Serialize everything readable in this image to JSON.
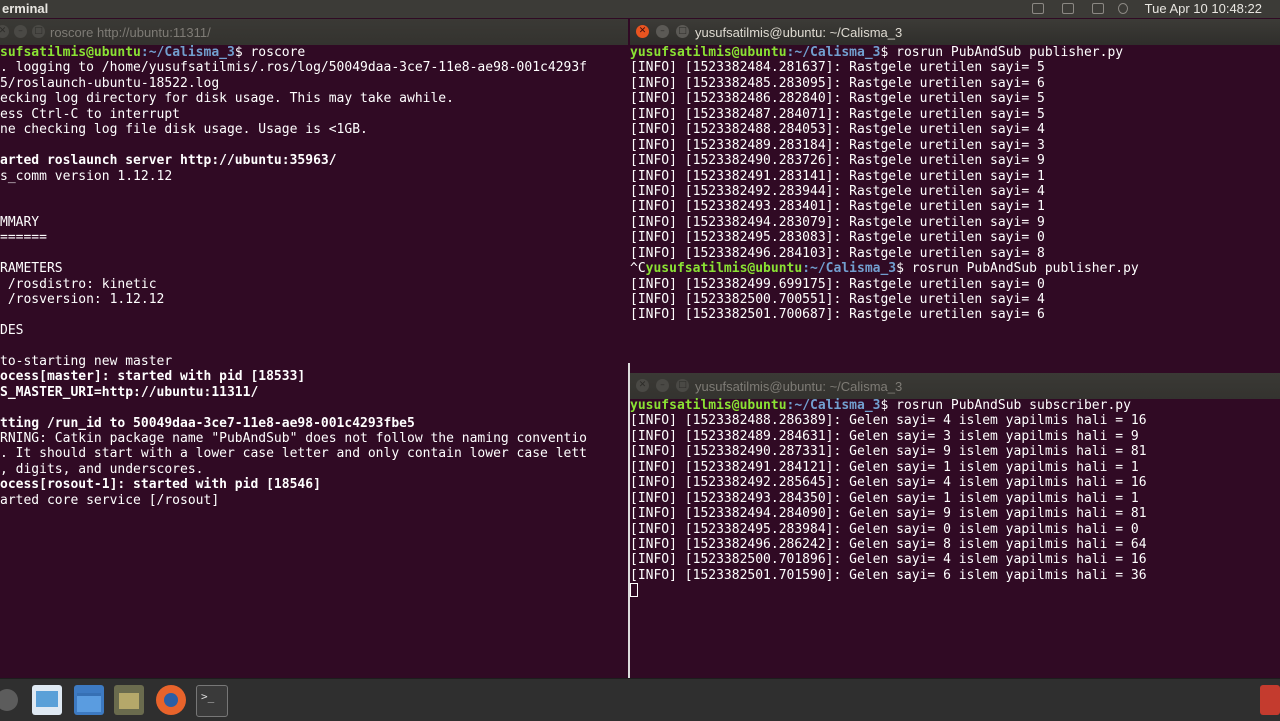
{
  "top_panel": {
    "app_title": "erminal",
    "clock": "Tue Apr 10 10:48:22"
  },
  "windows": {
    "left": {
      "title": "roscore http://ubuntu:11311/",
      "prompt_user": "yusufsatilmis@ubuntu",
      "prompt_path": ":~/Calisma_3",
      "lines": [
        {
          "t": "sufsatilmis@ubuntu:~/Calisma_3$ roscore",
          "s": "prompt"
        },
        {
          "t": ". logging to /home/yusufsatilmis/.ros/log/50049daa-3ce7-11e8-ae98-001c4293f",
          "s": ""
        },
        {
          "t": "5/roslaunch-ubuntu-18522.log",
          "s": ""
        },
        {
          "t": "ecking log directory for disk usage. This may take awhile.",
          "s": ""
        },
        {
          "t": "ess Ctrl-C to interrupt",
          "s": ""
        },
        {
          "t": "ne checking log file disk usage. Usage is <1GB.",
          "s": ""
        },
        {
          "t": "",
          "s": ""
        },
        {
          "t": "arted roslaunch server http://ubuntu:35963/",
          "s": "b"
        },
        {
          "t": "s_comm version 1.12.12",
          "s": ""
        },
        {
          "t": "",
          "s": ""
        },
        {
          "t": "",
          "s": ""
        },
        {
          "t": "MMARY",
          "s": ""
        },
        {
          "t": "======",
          "s": ""
        },
        {
          "t": "",
          "s": ""
        },
        {
          "t": "RAMETERS",
          "s": ""
        },
        {
          "t": " /rosdistro: kinetic",
          "s": ""
        },
        {
          "t": " /rosversion: 1.12.12",
          "s": ""
        },
        {
          "t": "",
          "s": ""
        },
        {
          "t": "DES",
          "s": ""
        },
        {
          "t": "",
          "s": ""
        },
        {
          "t": "to-starting new master",
          "s": ""
        },
        {
          "t": "ocess[master]: started with pid [18533]",
          "s": "b"
        },
        {
          "t": "S_MASTER_URI=http://ubuntu:11311/",
          "s": "b"
        },
        {
          "t": "",
          "s": ""
        },
        {
          "t": "tting /run_id to 50049daa-3ce7-11e8-ae98-001c4293fbe5",
          "s": "b"
        },
        {
          "t": "RNING: Catkin package name \"PubAndSub\" does not follow the naming conventio",
          "s": ""
        },
        {
          "t": ". It should start with a lower case letter and only contain lower case lett",
          "s": ""
        },
        {
          "t": ", digits, and underscores.",
          "s": ""
        },
        {
          "t": "ocess[rosout-1]: started with pid [18546]",
          "s": "b"
        },
        {
          "t": "arted core service [/rosout]",
          "s": ""
        }
      ]
    },
    "top_right": {
      "title": "yusufsatilmis@ubuntu: ~/Calisma_3",
      "lines": [
        {
          "u": "yusufsatilmis@ubuntu",
          "p": ":~/Calisma_3",
          "c": "$ rosrun PubAndSub publisher.py",
          "s": "prompt2"
        },
        {
          "t": "[INFO] [1523382484.281637]: Rastgele uretilen sayi= 5",
          "s": ""
        },
        {
          "t": "[INFO] [1523382485.283095]: Rastgele uretilen sayi= 6",
          "s": ""
        },
        {
          "t": "[INFO] [1523382486.282840]: Rastgele uretilen sayi= 5",
          "s": ""
        },
        {
          "t": "[INFO] [1523382487.284071]: Rastgele uretilen sayi= 5",
          "s": ""
        },
        {
          "t": "[INFO] [1523382488.284053]: Rastgele uretilen sayi= 4",
          "s": ""
        },
        {
          "t": "[INFO] [1523382489.283184]: Rastgele uretilen sayi= 3",
          "s": ""
        },
        {
          "t": "[INFO] [1523382490.283726]: Rastgele uretilen sayi= 9",
          "s": ""
        },
        {
          "t": "[INFO] [1523382491.283141]: Rastgele uretilen sayi= 1",
          "s": ""
        },
        {
          "t": "[INFO] [1523382492.283944]: Rastgele uretilen sayi= 4",
          "s": ""
        },
        {
          "t": "[INFO] [1523382493.283401]: Rastgele uretilen sayi= 1",
          "s": ""
        },
        {
          "t": "[INFO] [1523382494.283079]: Rastgele uretilen sayi= 9",
          "s": ""
        },
        {
          "t": "[INFO] [1523382495.283083]: Rastgele uretilen sayi= 0",
          "s": ""
        },
        {
          "t": "[INFO] [1523382496.284103]: Rastgele uretilen sayi= 8",
          "s": ""
        },
        {
          "pre": "^C",
          "u": "yusufsatilmis@ubuntu",
          "p": ":~/Calisma_3",
          "c": "$ rosrun PubAndSub publisher.py",
          "s": "prompt2"
        },
        {
          "t": "[INFO] [1523382499.699175]: Rastgele uretilen sayi= 0",
          "s": ""
        },
        {
          "t": "[INFO] [1523382500.700551]: Rastgele uretilen sayi= 4",
          "s": ""
        },
        {
          "t": "[INFO] [1523382501.700687]: Rastgele uretilen sayi= 6",
          "s": ""
        }
      ]
    },
    "bottom_right": {
      "title": "yusufsatilmis@ubuntu: ~/Calisma_3",
      "lines": [
        {
          "u": "yusufsatilmis@ubuntu",
          "p": ":~/Calisma_3",
          "c": "$ rosrun PubAndSub subscriber.py",
          "s": "prompt2"
        },
        {
          "t": "[INFO] [1523382488.286389]: Gelen sayi= 4 islem yapilmis hali = 16",
          "s": ""
        },
        {
          "t": "[INFO] [1523382489.284631]: Gelen sayi= 3 islem yapilmis hali = 9",
          "s": ""
        },
        {
          "t": "[INFO] [1523382490.287331]: Gelen sayi= 9 islem yapilmis hali = 81",
          "s": ""
        },
        {
          "t": "[INFO] [1523382491.284121]: Gelen sayi= 1 islem yapilmis hali = 1",
          "s": ""
        },
        {
          "t": "[INFO] [1523382492.285645]: Gelen sayi= 4 islem yapilmis hali = 16",
          "s": ""
        },
        {
          "t": "[INFO] [1523382493.284350]: Gelen sayi= 1 islem yapilmis hali = 1",
          "s": ""
        },
        {
          "t": "[INFO] [1523382494.284090]: Gelen sayi= 9 islem yapilmis hali = 81",
          "s": ""
        },
        {
          "t": "[INFO] [1523382495.283984]: Gelen sayi= 0 islem yapilmis hali = 0",
          "s": ""
        },
        {
          "t": "[INFO] [1523382496.286242]: Gelen sayi= 8 islem yapilmis hali = 64",
          "s": ""
        },
        {
          "t": "[INFO] [1523382500.701896]: Gelen sayi= 4 islem yapilmis hali = 16",
          "s": ""
        },
        {
          "t": "[INFO] [1523382501.701590]: Gelen sayi= 6 islem yapilmis hali = 36",
          "s": ""
        }
      ]
    }
  },
  "taskbar": {
    "items": [
      "show-desktop-icon",
      "files-icon",
      "folder-icon",
      "archive-icon",
      "firefox-icon",
      "terminal-icon",
      "trash-icon"
    ]
  }
}
